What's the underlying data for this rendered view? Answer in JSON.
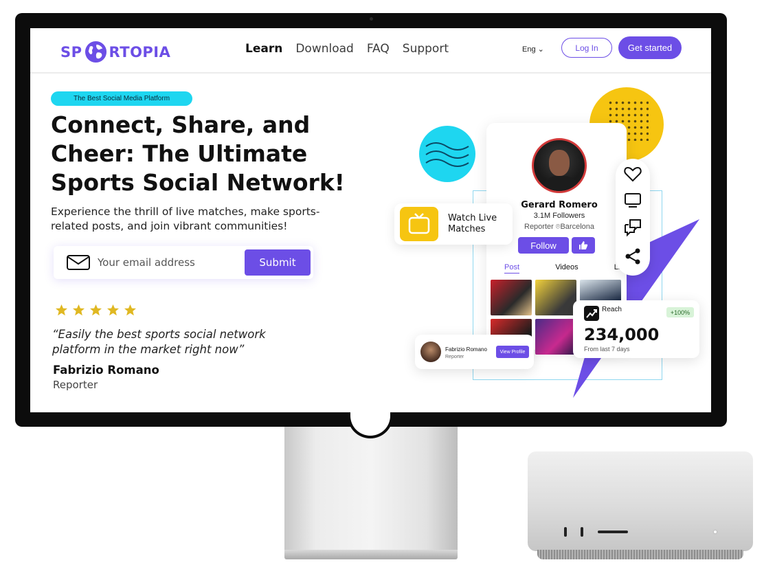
{
  "nav": {
    "logo_left": "SP",
    "logo_right": "RTOPIA",
    "links": [
      {
        "label": "Learn",
        "active": true
      },
      {
        "label": "Download",
        "active": false
      },
      {
        "label": "FAQ",
        "active": false
      },
      {
        "label": "Support",
        "active": false
      }
    ],
    "language": "Eng",
    "login_label": "Log In",
    "get_started_label": "Get started"
  },
  "hero": {
    "pill": "The Best Social Media Platform",
    "headline": "Connect, Share, and Cheer: The Ultimate Sports Social Network!",
    "subtext": "Experience the thrill of live matches, make sports-related posts, and join vibrant communities!",
    "email_placeholder": "Your email address",
    "submit_label": "Submit",
    "rating_stars": 5,
    "quote": "“Easily the best sports social network platform in the market right now”",
    "quote_author": "Fabrizio Romano",
    "quote_role": "Reporter"
  },
  "profile": {
    "name": "Gerard Romero",
    "followers": "3.1M Followers",
    "location": "Reporter ⌾Barcelona",
    "follow_label": "Follow",
    "tabs": [
      "Post",
      "Videos",
      "Live"
    ],
    "active_tab": "Post"
  },
  "watch_card": {
    "label": "Watch Live Matches"
  },
  "reach_card": {
    "label": "Reach",
    "badge": "+100%",
    "value": "234,000",
    "sub": "From last 7 days"
  },
  "fab_card": {
    "name": "Fabrizio Romano",
    "role": "Reporter",
    "button": "View Profile"
  },
  "colors": {
    "accent": "#6c4ee6",
    "cyan": "#1ed6f0",
    "yellow": "#f6c511",
    "star": "#e0b822"
  },
  "icons": [
    "globe-icon",
    "chevron-down-icon",
    "mail-icon",
    "star-icon",
    "heart-icon",
    "tv-icon",
    "chat-icon",
    "share-icon",
    "thumbs-up-icon",
    "trend-icon"
  ]
}
